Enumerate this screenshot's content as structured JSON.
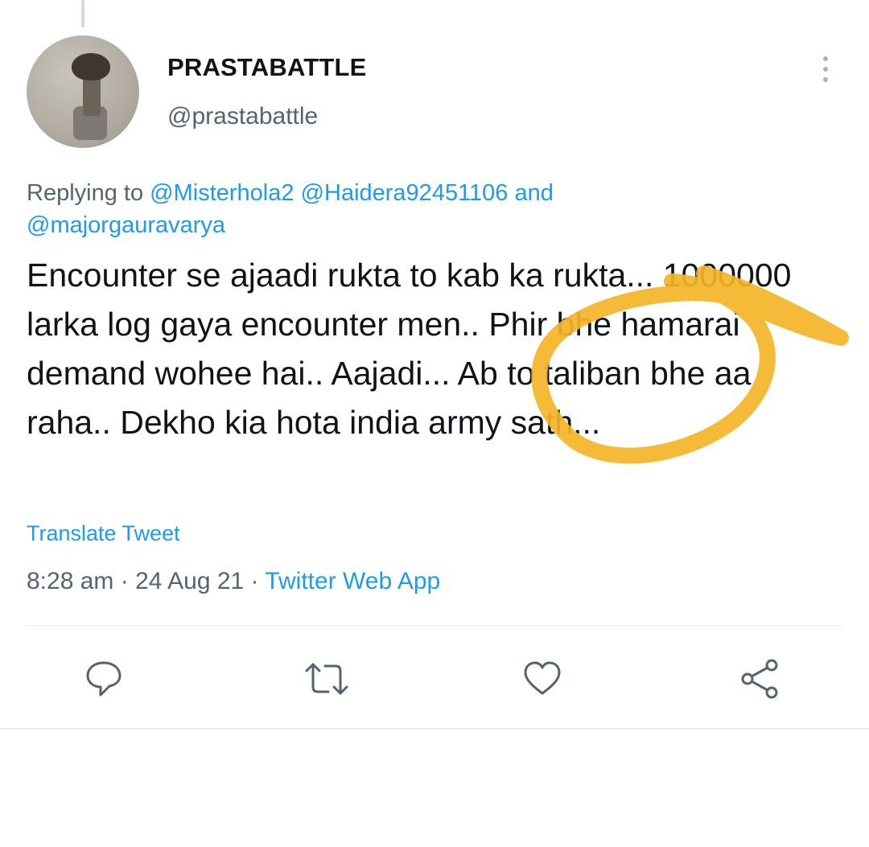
{
  "tweet": {
    "display_name": "PRASTABATTLE",
    "handle": "@prastabattle",
    "replying_label": "Replying to",
    "replying_mentions": [
      "@Misterhola2",
      "@Haidera92451106"
    ],
    "replying_and": "and",
    "replying_last": "@majorgauravarya",
    "text": "Encounter se ajaadi rukta to kab ka rukta... 1000000 larka log gaya encounter men.. Phir bhe hamarai demand wohee hai.. Aajadi... Ab to taliban bhe aa raha.. Dekho kia hota india army sath...",
    "translate_label": "Translate Tweet",
    "time": "8:28 am",
    "separator": " · ",
    "date": "24 Aug 21",
    "source": "Twitter Web App"
  },
  "icons": {
    "more": "more-vertical-icon",
    "reply": "reply-icon",
    "retweet": "retweet-icon",
    "like": "heart-icon",
    "share": "share-icon"
  },
  "colors": {
    "link": "#1d9bf0",
    "secondary_text": "#536471",
    "annotation": "#f3b427"
  }
}
